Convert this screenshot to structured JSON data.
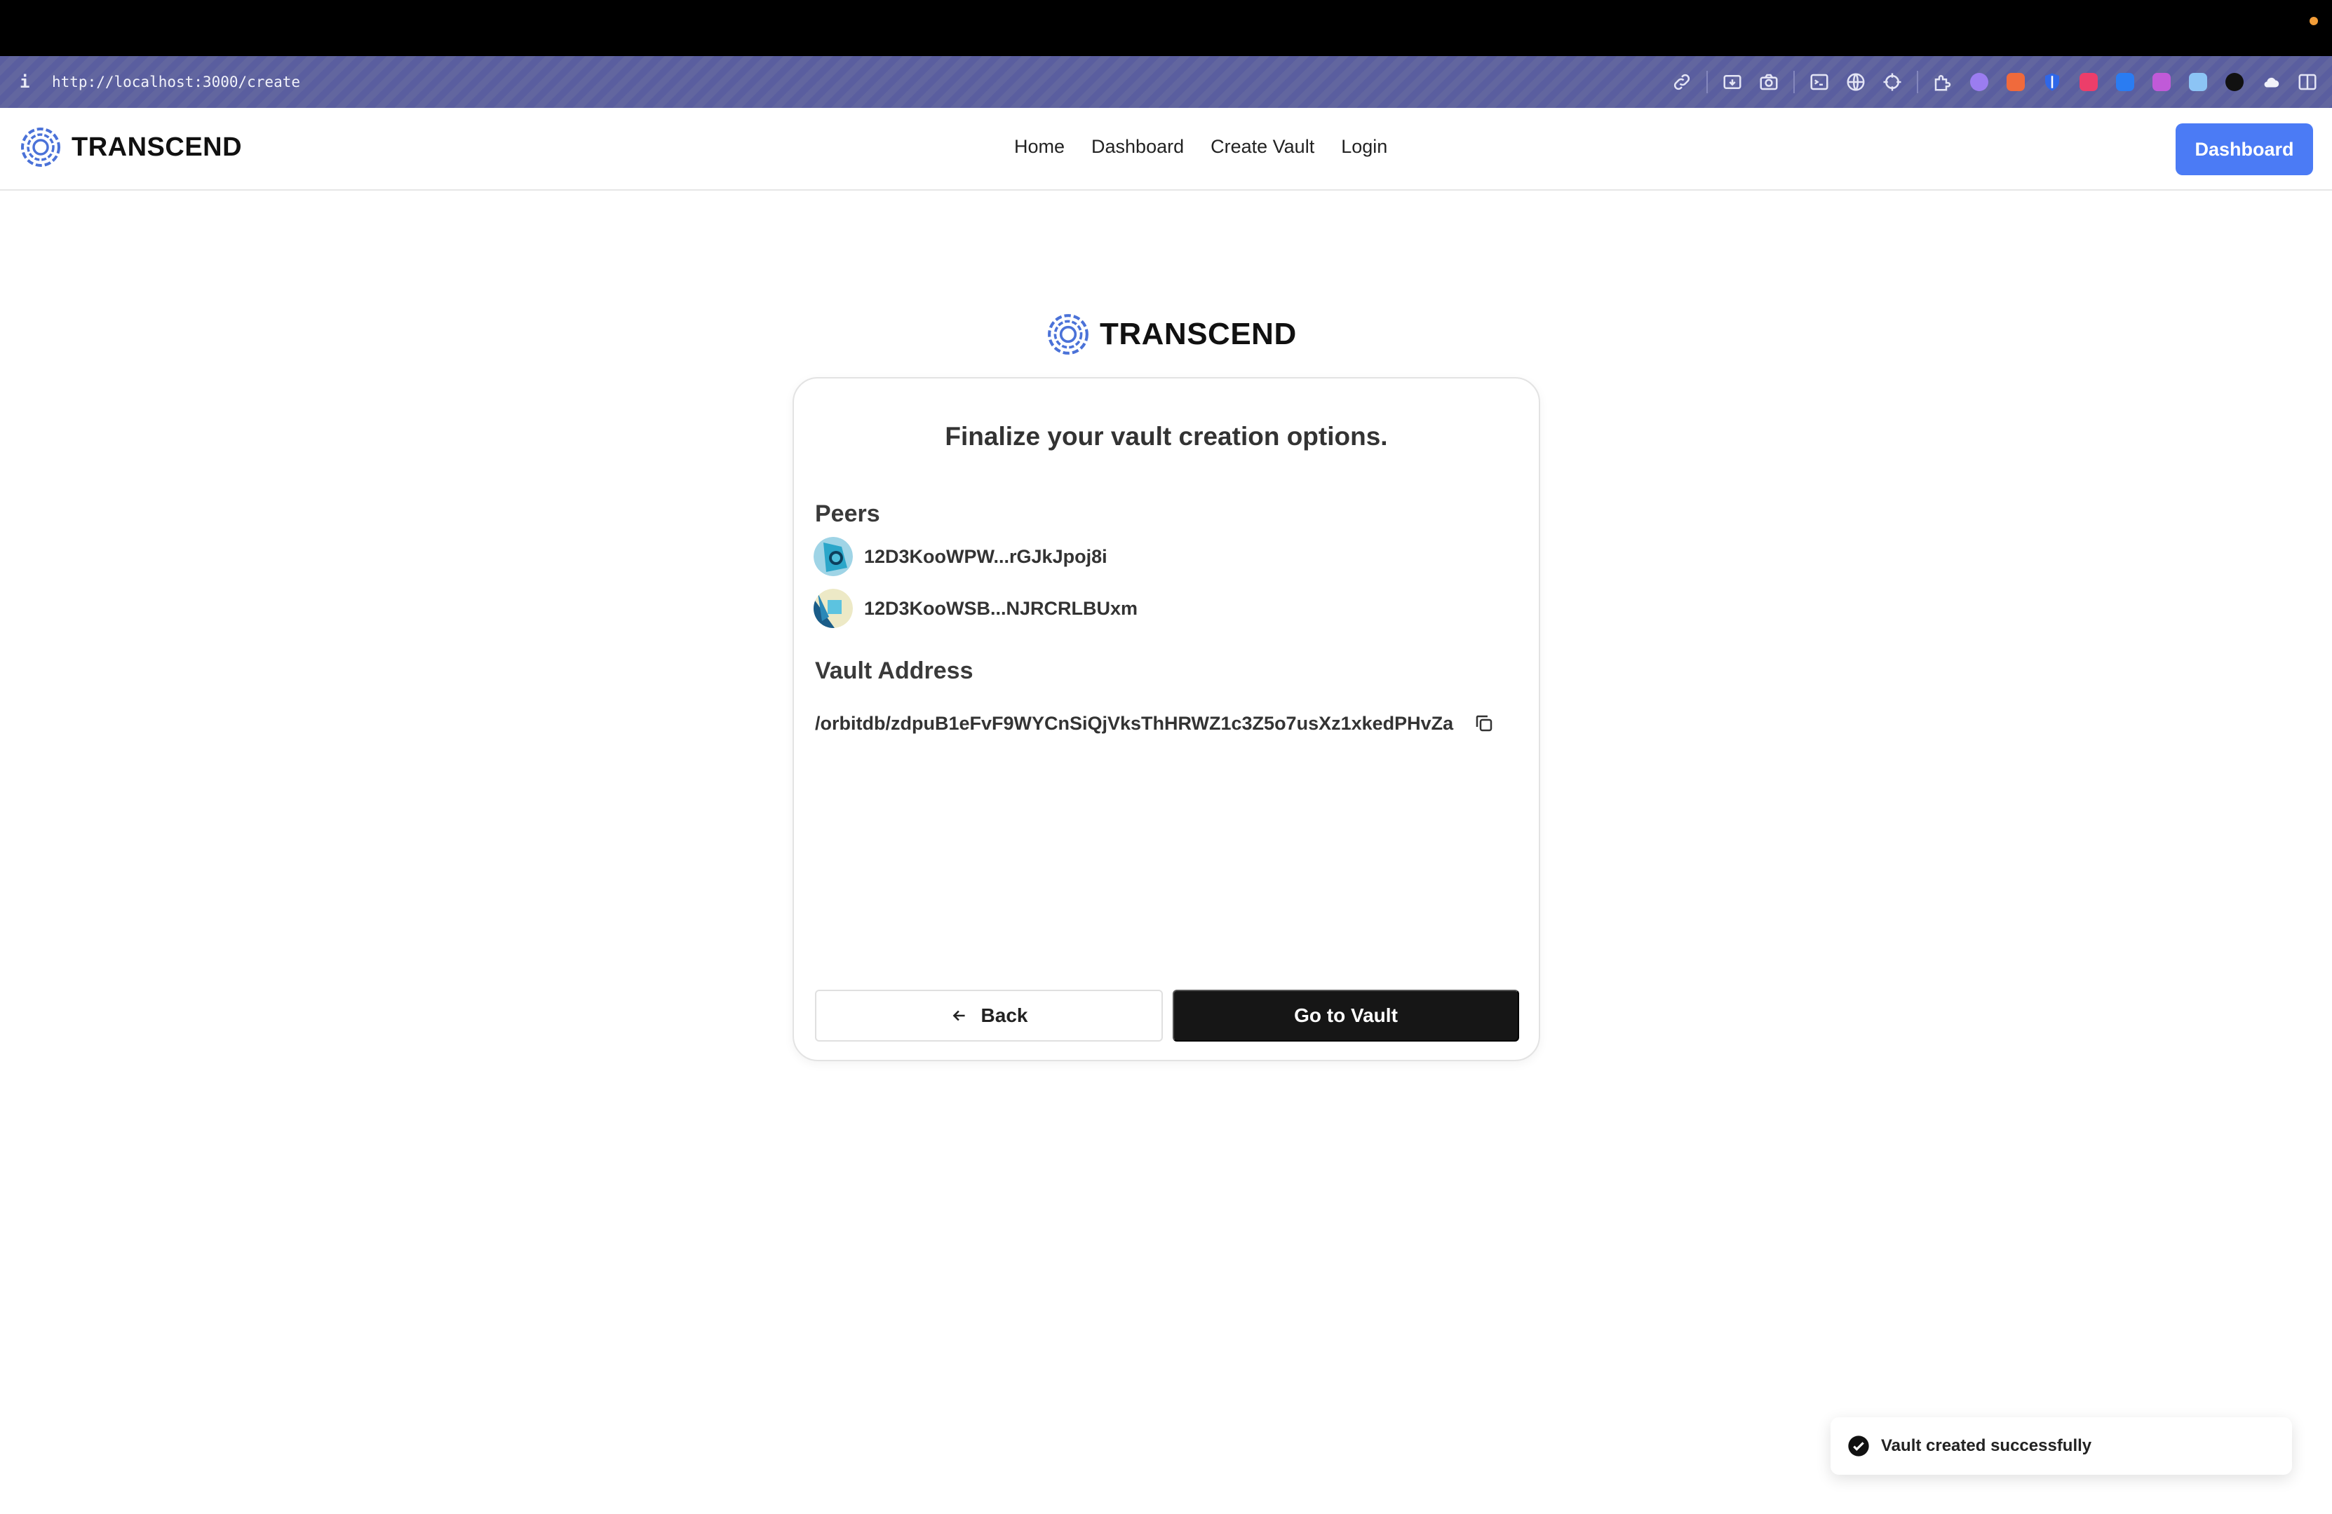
{
  "browser": {
    "info_glyph": "i",
    "url": "http://localhost:3000/create",
    "extensions": [
      "link-icon",
      "screenshot-icon",
      "camera-icon",
      "terminal-icon",
      "globe-icon",
      "crosshair-icon",
      "puzzle-icon",
      "face-icon",
      "brush-icon",
      "shield-icon",
      "bookmark-icon",
      "k-icon",
      "bug-icon",
      "book-icon",
      "paint-icon",
      "cloud-icon",
      "sidebar-icon"
    ]
  },
  "header": {
    "brand": "TRANSCEND",
    "nav": [
      "Home",
      "Dashboard",
      "Create Vault",
      "Login"
    ],
    "cta": "Dashboard"
  },
  "main": {
    "brand": "TRANSCEND",
    "card": {
      "title": "Finalize your vault creation options.",
      "peers_label": "Peers",
      "peers": [
        {
          "id": "12D3KooWPW...rGJkJpoj8i"
        },
        {
          "id": "12D3KooWSB...NJRCRLBUxm"
        }
      ],
      "address_label": "Vault Address",
      "address": "/orbitdb/zdpuB1eFvF9WYCnSiQjVksThHRWZ1c3Z5o7usXz1xkedPHvZa",
      "back_label": "Back",
      "go_label": "Go to Vault"
    }
  },
  "toast": {
    "message": "Vault created successfully"
  },
  "colors": {
    "accent": "#4b7bf5",
    "primary_button": "#161616",
    "browser_bar": "#5a5e9f"
  }
}
